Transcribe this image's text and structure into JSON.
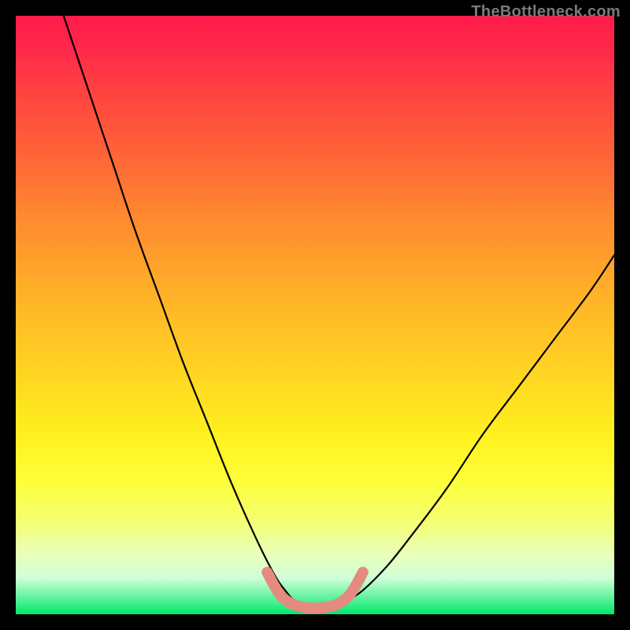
{
  "watermark": {
    "text": "TheBottleneck.com"
  },
  "chart_data": {
    "type": "line",
    "title": "",
    "xlabel": "",
    "ylabel": "",
    "xlim": [
      0,
      100
    ],
    "ylim": [
      0,
      100
    ],
    "series": [
      {
        "name": "bottleneck-curve",
        "x": [
          8,
          12,
          16,
          20,
          24,
          28,
          32,
          36,
          40,
          43,
          45,
          47,
          50,
          53,
          55,
          58,
          62,
          66,
          72,
          78,
          84,
          90,
          96,
          100
        ],
        "values": [
          100,
          88,
          76,
          64,
          53,
          42,
          32,
          22,
          13,
          7,
          4,
          2,
          1,
          1,
          2,
          4,
          8,
          13,
          21,
          30,
          38,
          46,
          54,
          60
        ]
      }
    ],
    "highlight_segment": {
      "name": "optimal-zone",
      "x": [
        42,
        44,
        46,
        48,
        50,
        52,
        54,
        56,
        58
      ],
      "values": [
        7,
        3.5,
        1.8,
        1.2,
        1,
        1.2,
        1.8,
        3.5,
        7
      ]
    },
    "colors": {
      "curve": "#000000",
      "highlight": "#e58a80"
    }
  }
}
